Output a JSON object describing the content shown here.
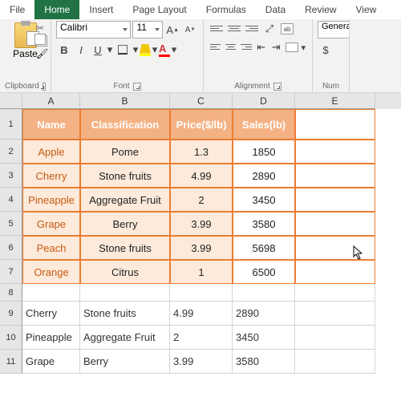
{
  "tabs": [
    "File",
    "Home",
    "Insert",
    "Page Layout",
    "Formulas",
    "Data",
    "Review",
    "View"
  ],
  "activeTab": 1,
  "clipboard": {
    "paste": "Paste",
    "label": "Clipboard"
  },
  "font": {
    "name": "Calibri",
    "size": "11",
    "label": "Font",
    "bold": "B",
    "italic": "I",
    "underline": "U",
    "incA": "A",
    "decA": "A"
  },
  "alignment": {
    "label": "Alignment",
    "wrap": "ab"
  },
  "number": {
    "label": "Num",
    "format": "Genera"
  },
  "columns": [
    "A",
    "B",
    "C",
    "D",
    "E"
  ],
  "headerRow": {
    "name": "Name",
    "class": "Classification",
    "price": "Price($/lb)",
    "sales": "Sales(lb)"
  },
  "rows": [
    {
      "name": "Apple",
      "class": "Pome",
      "price": "1.3",
      "sales": "1850"
    },
    {
      "name": "Cherry",
      "class": "Stone fruits",
      "price": "4.99",
      "sales": "2890"
    },
    {
      "name": "Pineapple",
      "class": "Aggregate Fruit",
      "price": "2",
      "sales": "3450"
    },
    {
      "name": "Grape",
      "class": "Berry",
      "price": "3.99",
      "sales": "3580"
    },
    {
      "name": "Peach",
      "class": "Stone fruits",
      "price": "3.99",
      "sales": "5698"
    },
    {
      "name": "Orange",
      "class": "Citrus",
      "price": "1",
      "sales": "6500"
    }
  ],
  "plainRows": [
    {
      "name": "Cherry",
      "class": "Stone fruits",
      "price": "4.99",
      "sales": "2890"
    },
    {
      "name": "Pineapple",
      "class": "Aggregate Fruit",
      "price": "2",
      "sales": "3450"
    },
    {
      "name": "Grape",
      "class": "Berry",
      "price": "3.99",
      "sales": "3580"
    }
  ]
}
